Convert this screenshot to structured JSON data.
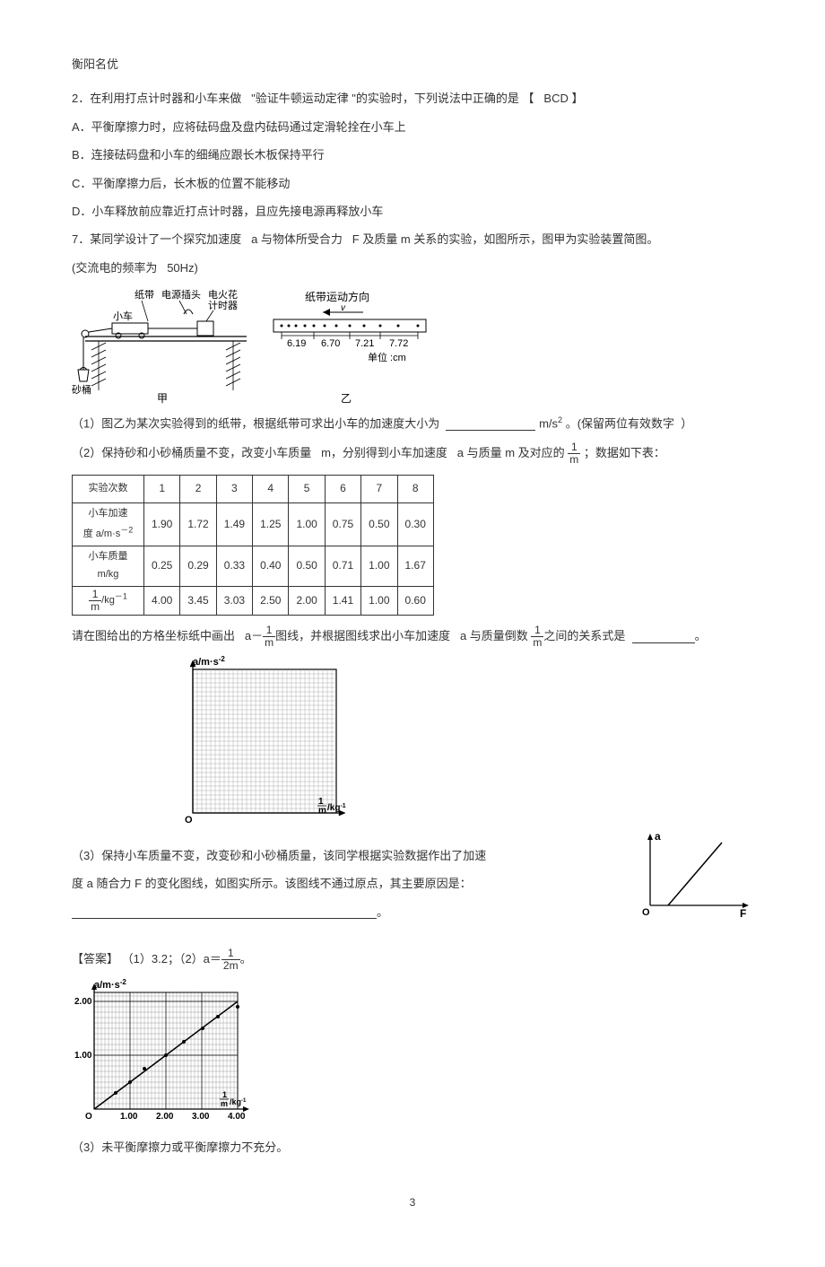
{
  "header": "衡阳名优",
  "q2": {
    "stem_a": "2．在利用打点计时器和小车来做",
    "stem_b": "\"验证牛顿运动定律 \"的实验时，下列说法中正确的是",
    "bracket_l": "【",
    "answer": "BCD",
    "bracket_r": "】",
    "A": "A．平衡摩擦力时，应将砝码盘及盘内砝码通过定滑轮拴在小车上",
    "B": "B．连接砝码盘和小车的细绳应跟长木板保持平行",
    "C": "C．平衡摩擦力后，长木板的位置不能移动",
    "D": "D．小车释放前应靠近打点计时器，且应先接电源再释放小车"
  },
  "q7": {
    "stem_a": "7．某同学设计了一个探究加速度",
    "stem_b": "a 与物体所受合力",
    "stem_c": "F 及质量 m 关系的实验，如图所示，图甲为实验装置简图。",
    "stem_d": "(交流电的频率为",
    "stem_e": "50Hz)",
    "diagram_labels": {
      "tape": "纸带",
      "plug": "电源插头",
      "sparker": "电火花\n计时器",
      "cart": "小车",
      "bucket": "砂桶",
      "jia": "甲",
      "yi": "乙",
      "tape_dir": "纸带运动方向",
      "v": "v",
      "seg1": "6.19",
      "seg2": "6.70",
      "seg3": "7.21",
      "seg4": "7.72",
      "unit": "单位 :cm"
    },
    "p1_a": "（1）图乙为某次实验得到的纸带，根据纸带可求出小车的加速度大小为",
    "p1_b": "m/s",
    "p1_c": "。(保留两位有效数字",
    "p1_d": "）",
    "p2_a": "（2）保持砂和小砂桶质量不变，改变小车质量",
    "p2_b": "m，分别得到小车加速度",
    "p2_c": "a 与质量 m 及对应的",
    "p2_d": "；数据如下表：",
    "table_headers": {
      "trial": "实验次数",
      "accel": "小车加速\n度 a/m·s",
      "mass": "小车质量\nm/kg",
      "invmass_a": "1",
      "invmass_b": "m",
      "invmass_unit": "/kg"
    },
    "p2_e": "请在图给出的方格坐标纸中画出",
    "p2_f": "a－",
    "p2_g": "图线，并根据图线求出小车加速度",
    "p2_h": "a 与质量倒数",
    "p2_i": "之间的关系式是",
    "p2_j": "。",
    "grid_y_label": "a/m·s",
    "grid_x_label_a": "1",
    "grid_x_label_b": "m",
    "grid_x_unit": "/kg",
    "p3_a": "（3）保持小车质量不变，改变砂和小砂桶质量，该同学根据实验数据作出了加速",
    "p3_b": "度 a 随合力 F 的变化图线，如图实所示。该图线不通过原点，其主要原因是：",
    "p3_c": "。",
    "af_a": "a",
    "af_F": "F",
    "af_O": "O"
  },
  "answer": {
    "label": "【答案】",
    "a1": "（1）3.2；（2）a＝",
    "a1_end": "。",
    "frac_num": "1",
    "frac_den": "2m",
    "plot_y": "a/m·s",
    "plot_x_a": "1",
    "plot_x_b": "m",
    "plot_x_unit": "/kg",
    "y_2": "2.00",
    "y_1": "1.00",
    "x_1": "1.00",
    "x_2": "2.00",
    "x_3": "3.00",
    "x_4": "4.00",
    "a3": "（3）未平衡摩擦力或平衡摩擦力不充分。"
  },
  "page_num": "3",
  "chart_data": {
    "type": "table",
    "title": "a vs m and 1/m data",
    "columns": [
      "实验次数",
      "小车加速度 a/m·s⁻²",
      "小车质量 m/kg",
      "1/m /kg⁻¹"
    ],
    "rows": [
      [
        1,
        1.9,
        0.25,
        4.0
      ],
      [
        2,
        1.72,
        0.29,
        3.45
      ],
      [
        3,
        1.49,
        0.33,
        3.03
      ],
      [
        4,
        1.25,
        0.4,
        2.5
      ],
      [
        5,
        1.0,
        0.5,
        2.0
      ],
      [
        6,
        0.75,
        0.71,
        1.41
      ],
      [
        7,
        0.5,
        1.0,
        1.0
      ],
      [
        8,
        0.3,
        1.67,
        0.6
      ]
    ]
  }
}
